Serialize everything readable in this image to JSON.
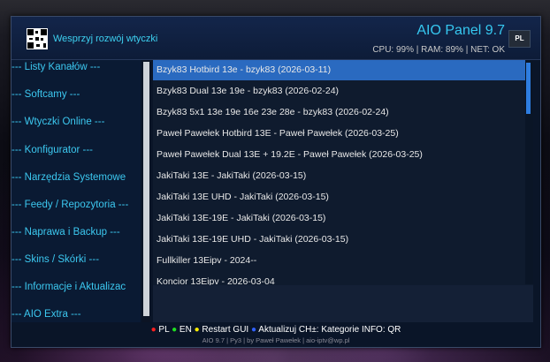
{
  "header": {
    "donate_label": "Wesprzyj rozwój wtyczki",
    "app_title": "AIO Panel 9.7",
    "stats": "CPU: 99% | RAM: 89% | NET: OK",
    "lang_button": "PL"
  },
  "sidebar": {
    "items": [
      {
        "label": "---  Listy Kanałów ---"
      },
      {
        "label": "--- Softcamy ---"
      },
      {
        "label": "--- Wtyczki Online ---"
      },
      {
        "label": "--- Konfigurator ---"
      },
      {
        "label": "--- Narzędzia Systemowe"
      },
      {
        "label": "--- Feedy / Repozytoria ---"
      },
      {
        "label": "--- Naprawa i Backup ---"
      },
      {
        "label": "--- Skins / Skórki ---"
      },
      {
        "label": "--- Informacje i Aktualizac"
      },
      {
        "label": "--- AIO Extra ---"
      }
    ]
  },
  "list": {
    "selected_index": 0,
    "items": [
      {
        "label": "Bzyk83 Hotbird 13e - bzyk83 (2026-03-11)"
      },
      {
        "label": "Bzyk83 Dual 13e 19e - bzyk83 (2026-02-24)"
      },
      {
        "label": "Bzyk83 5x1 13e 19e 16e 23e 28e - bzyk83 (2026-02-24)"
      },
      {
        "label": "Paweł Pawełek Hotbird 13E - Paweł Pawełek (2026-03-25)"
      },
      {
        "label": "Paweł Pawełek Dual 13E + 19.2E - Paweł Pawełek (2026-03-25)"
      },
      {
        "label": "JakiTaki 13E - JakiTaki (2026-03-15)"
      },
      {
        "label": "JakiTaki 13E UHD - JakiTaki (2026-03-15)"
      },
      {
        "label": "JakiTaki 13E-19E - JakiTaki (2026-03-15)"
      },
      {
        "label": "JakiTaki 13E-19E UHD - JakiTaki (2026-03-15)"
      },
      {
        "label": "Fullkiller 13Eipv - 2024--"
      },
      {
        "label": "Koncior 13Eipv - 2026-03-04"
      }
    ]
  },
  "footer": {
    "red_label": "PL",
    "green_label": "EN",
    "yellow_label": "Restart GUI",
    "blue_label": "Aktualizuj",
    "ch_label": "CH±: Kategorie",
    "info_label": "INFO: QR",
    "credit": "AIO 9.7 | Py3 | by Paweł Pawełek | aio-iptv@wp.pl"
  },
  "colors": {
    "accent": "#36c8f0",
    "selected_row": "#2a6ac0",
    "panel_bg": "#0a1528"
  }
}
